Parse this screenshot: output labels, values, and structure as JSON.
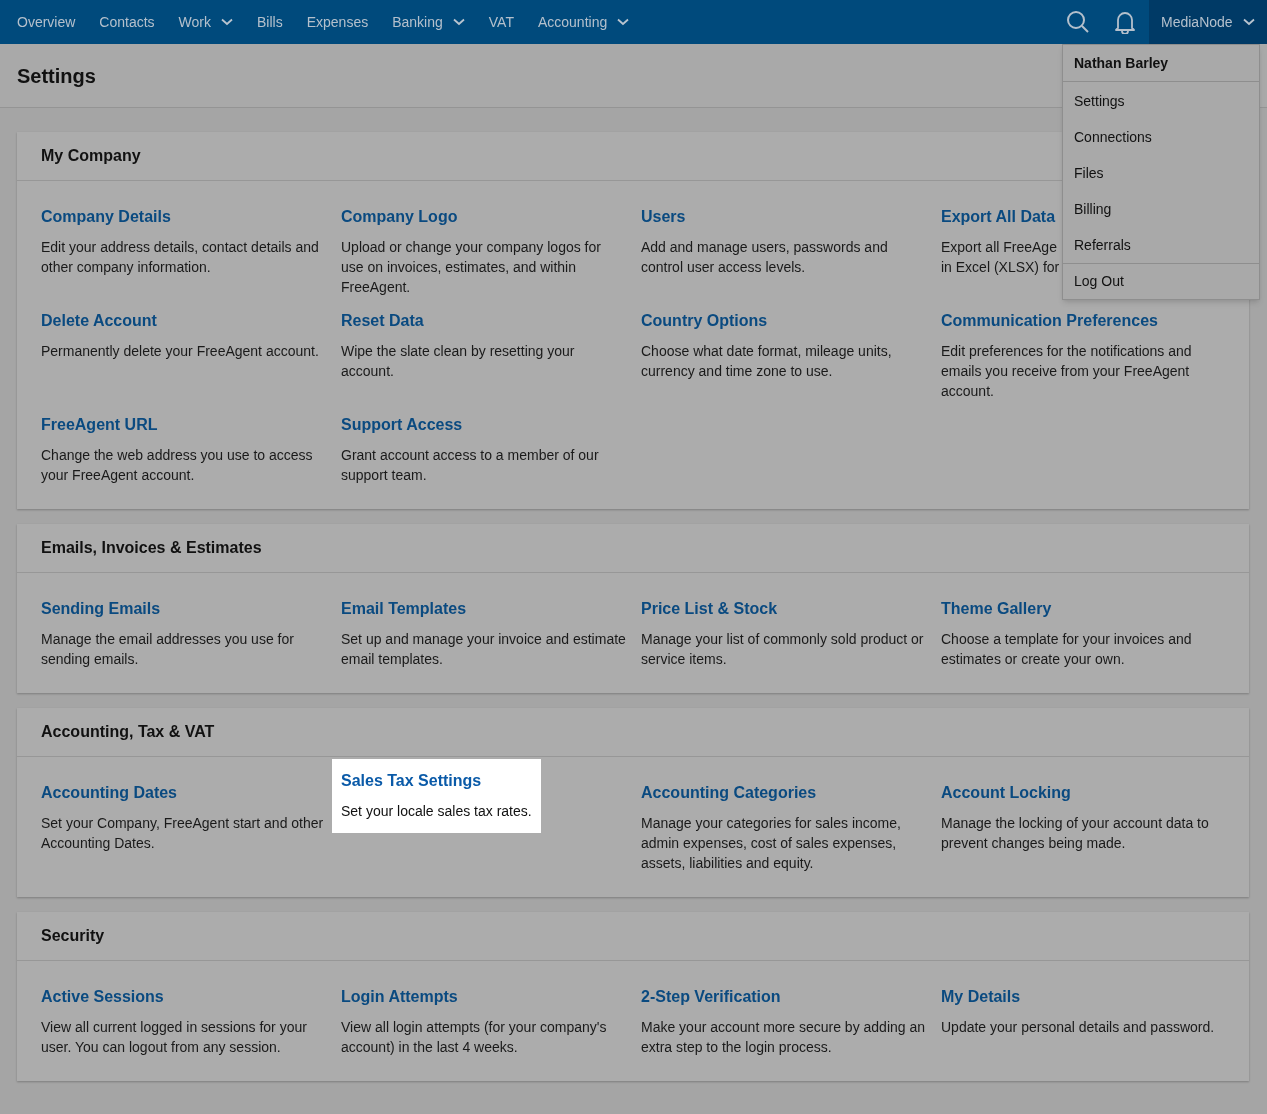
{
  "nav": {
    "items": [
      {
        "label": "Overview",
        "dropdown": false
      },
      {
        "label": "Contacts",
        "dropdown": false
      },
      {
        "label": "Work",
        "dropdown": true
      },
      {
        "label": "Bills",
        "dropdown": false
      },
      {
        "label": "Expenses",
        "dropdown": false
      },
      {
        "label": "Banking",
        "dropdown": true
      },
      {
        "label": "VAT",
        "dropdown": false
      },
      {
        "label": "Accounting",
        "dropdown": true
      }
    ],
    "account": "MediaNode"
  },
  "user_menu": {
    "name": "Nathan Barley",
    "items": [
      {
        "label": "Settings",
        "divider_before": false
      },
      {
        "label": "Connections",
        "divider_before": false
      },
      {
        "label": "Files",
        "divider_before": false
      },
      {
        "label": "Billing",
        "divider_before": false
      },
      {
        "label": "Referrals",
        "divider_before": false
      },
      {
        "label": "Log Out",
        "divider_before": true
      }
    ]
  },
  "page_title": "Settings",
  "sections": [
    {
      "title": "My Company",
      "items": [
        {
          "title": "Company Details",
          "lines": [
            "Edit your address details, contact details and other company information."
          ],
          "highlighted": false
        },
        {
          "title": "Company Logo",
          "lines": [
            "Upload or change your company logos for use on invoices, estimates, and within FreeAgent."
          ],
          "highlighted": false
        },
        {
          "title": "Users",
          "lines": [
            "Add and manage users, passwords and control user access levels."
          ],
          "highlighted": false
        },
        {
          "title": "Export All Data",
          "lines": [
            "Export all FreeAge",
            "in Excel (XLSX) for"
          ],
          "highlighted": false
        },
        {
          "title": "Delete Account",
          "lines": [
            "Permanently delete your FreeAgent account."
          ],
          "highlighted": false
        },
        {
          "title": "Reset Data",
          "lines": [
            "Wipe the slate clean by resetting your account."
          ],
          "highlighted": false
        },
        {
          "title": "Country Options",
          "lines": [
            "Choose what date format, mileage units, currency and time zone to use."
          ],
          "highlighted": false
        },
        {
          "title": "Communication Preferences",
          "lines": [
            "Edit preferences for the notifications and emails you receive from your FreeAgent account."
          ],
          "highlighted": false
        },
        {
          "title": "FreeAgent URL",
          "lines": [
            "Change the web address you use to access your FreeAgent account."
          ],
          "highlighted": false
        },
        {
          "title": "Support Access",
          "lines": [
            "Grant account access to a member of our support team."
          ],
          "highlighted": false
        }
      ]
    },
    {
      "title": "Emails, Invoices & Estimates",
      "items": [
        {
          "title": "Sending Emails",
          "lines": [
            "Manage the email addresses you use for sending emails."
          ],
          "highlighted": false
        },
        {
          "title": "Email Templates",
          "lines": [
            "Set up and manage your invoice and estimate email templates."
          ],
          "highlighted": false
        },
        {
          "title": "Price List & Stock",
          "lines": [
            "Manage your list of commonly sold product or service items."
          ],
          "highlighted": false
        },
        {
          "title": "Theme Gallery",
          "lines": [
            "Choose a template for your invoices and estimates or create your own."
          ],
          "highlighted": false
        }
      ]
    },
    {
      "title": "Accounting, Tax & VAT",
      "items": [
        {
          "title": "Accounting Dates",
          "lines": [
            "Set your Company, FreeAgent start and other Accounting Dates."
          ],
          "highlighted": false
        },
        {
          "title": "Sales Tax Settings",
          "lines": [
            "Set your locale sales tax rates."
          ],
          "highlighted": true
        },
        {
          "title": "Accounting Categories",
          "lines": [
            "Manage your categories for sales income, admin expenses, cost of sales expenses, assets, liabilities and equity."
          ],
          "highlighted": false
        },
        {
          "title": "Account Locking",
          "lines": [
            "Manage the locking of your account data to prevent changes being made."
          ],
          "highlighted": false
        }
      ]
    },
    {
      "title": "Security",
      "items": [
        {
          "title": "Active Sessions",
          "lines": [
            "View all current logged in sessions for your user. You can logout from any session."
          ],
          "highlighted": false
        },
        {
          "title": "Login Attempts",
          "lines": [
            "View all login attempts (for your company's account) in the last 4 weeks."
          ],
          "highlighted": false
        },
        {
          "title": "2-Step Verification",
          "lines": [
            "Make your account more secure by adding an extra step to the login process."
          ],
          "highlighted": false
        },
        {
          "title": "My Details",
          "lines": [
            "Update your personal details and password."
          ],
          "highlighted": false
        }
      ]
    }
  ]
}
